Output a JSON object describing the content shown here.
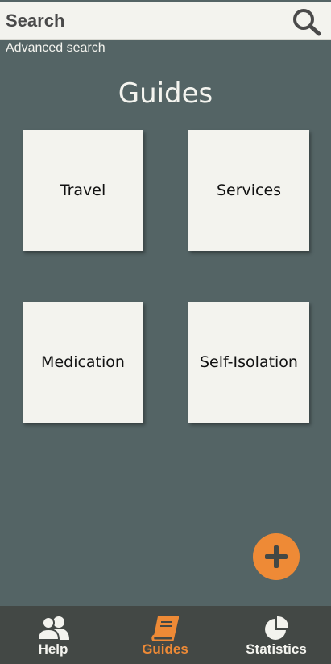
{
  "search": {
    "placeholder": "Search",
    "advanced_label": "Advanced search",
    "icon": "search-icon"
  },
  "page": {
    "title": "Guides"
  },
  "guides": [
    {
      "label": "Travel"
    },
    {
      "label": "Services"
    },
    {
      "label": "Medication"
    },
    {
      "label": "Self-Isolation"
    }
  ],
  "fab": {
    "icon": "plus-icon"
  },
  "nav": {
    "items": [
      {
        "label": "Help",
        "icon": "people-icon",
        "active": false
      },
      {
        "label": "Guides",
        "icon": "book-icon",
        "active": true
      },
      {
        "label": "Statistics",
        "icon": "pie-chart-icon",
        "active": false
      }
    ]
  },
  "colors": {
    "background": "#546465",
    "card": "#f3f3ee",
    "accent": "#ee8a36",
    "nav_bar": "#434845",
    "text_light": "#f4f4ef"
  }
}
